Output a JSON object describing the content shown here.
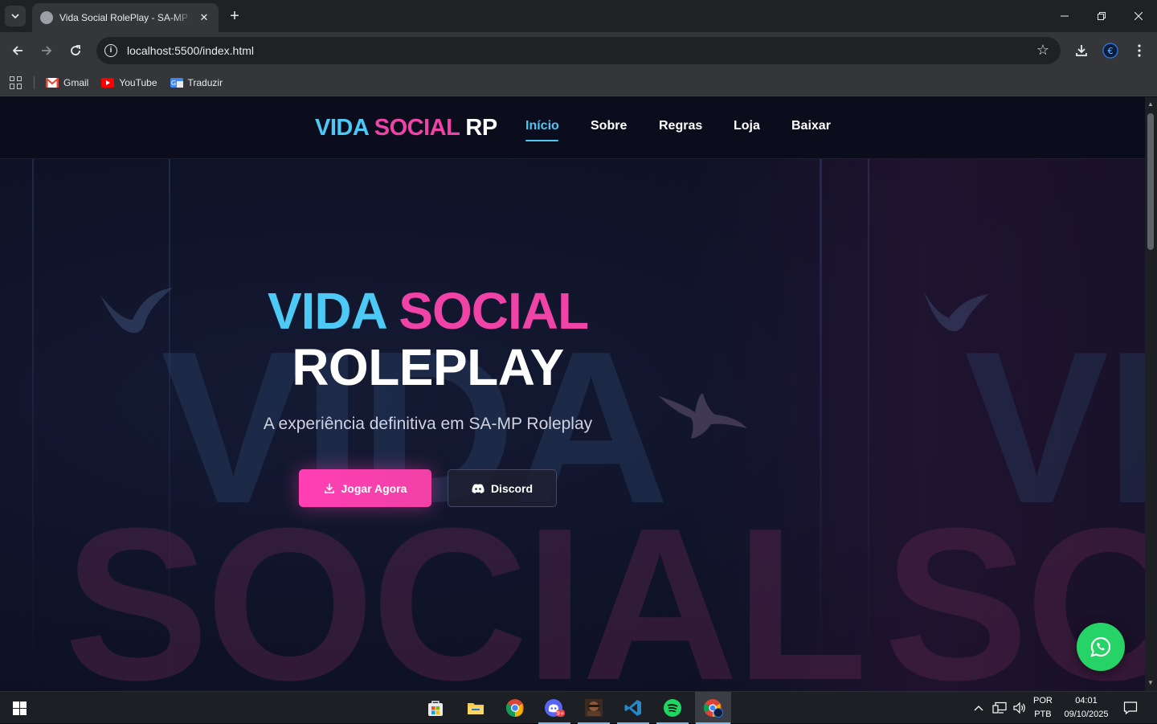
{
  "browser": {
    "tab_title": "Vida Social RolePlay - SA-MP Server",
    "url": "localhost:5500/index.html",
    "bookmarks": [
      {
        "label": "Gmail",
        "icon": "gmail-icon"
      },
      {
        "label": "YouTube",
        "icon": "youtube-icon"
      },
      {
        "label": "Traduzir",
        "icon": "translate-icon"
      }
    ]
  },
  "site": {
    "logo": {
      "part1": "VIDA",
      "part2": "SOCIAL",
      "part3": "RP"
    },
    "nav": [
      {
        "label": "Início",
        "active": true
      },
      {
        "label": "Sobre",
        "active": false
      },
      {
        "label": "Regras",
        "active": false
      },
      {
        "label": "Loja",
        "active": false
      },
      {
        "label": "Baixar",
        "active": false
      }
    ],
    "hero": {
      "title_word1": "VIDA",
      "title_word2": "SOCIAL",
      "title_line2": "ROLEPLAY",
      "subtitle": "A experiência definitiva em SA-MP Roleplay",
      "play_button": "Jogar Agora",
      "discord_button": "Discord",
      "bg_text_1": "VIDA",
      "bg_text_2": "SOCIAL"
    },
    "colors": {
      "cyan": "#4cc9f5",
      "pink": "#f043a8",
      "whatsapp": "#25d366"
    }
  },
  "taskbar": {
    "language": "POR",
    "layout": "PTB",
    "time": "04:01",
    "date": "09/10/2025",
    "apps": [
      "store-icon",
      "file-explorer-icon",
      "chrome-icon",
      "discord-icon",
      "game-icon",
      "vscode-icon",
      "spotify-icon",
      "chrome-profile-icon"
    ]
  }
}
